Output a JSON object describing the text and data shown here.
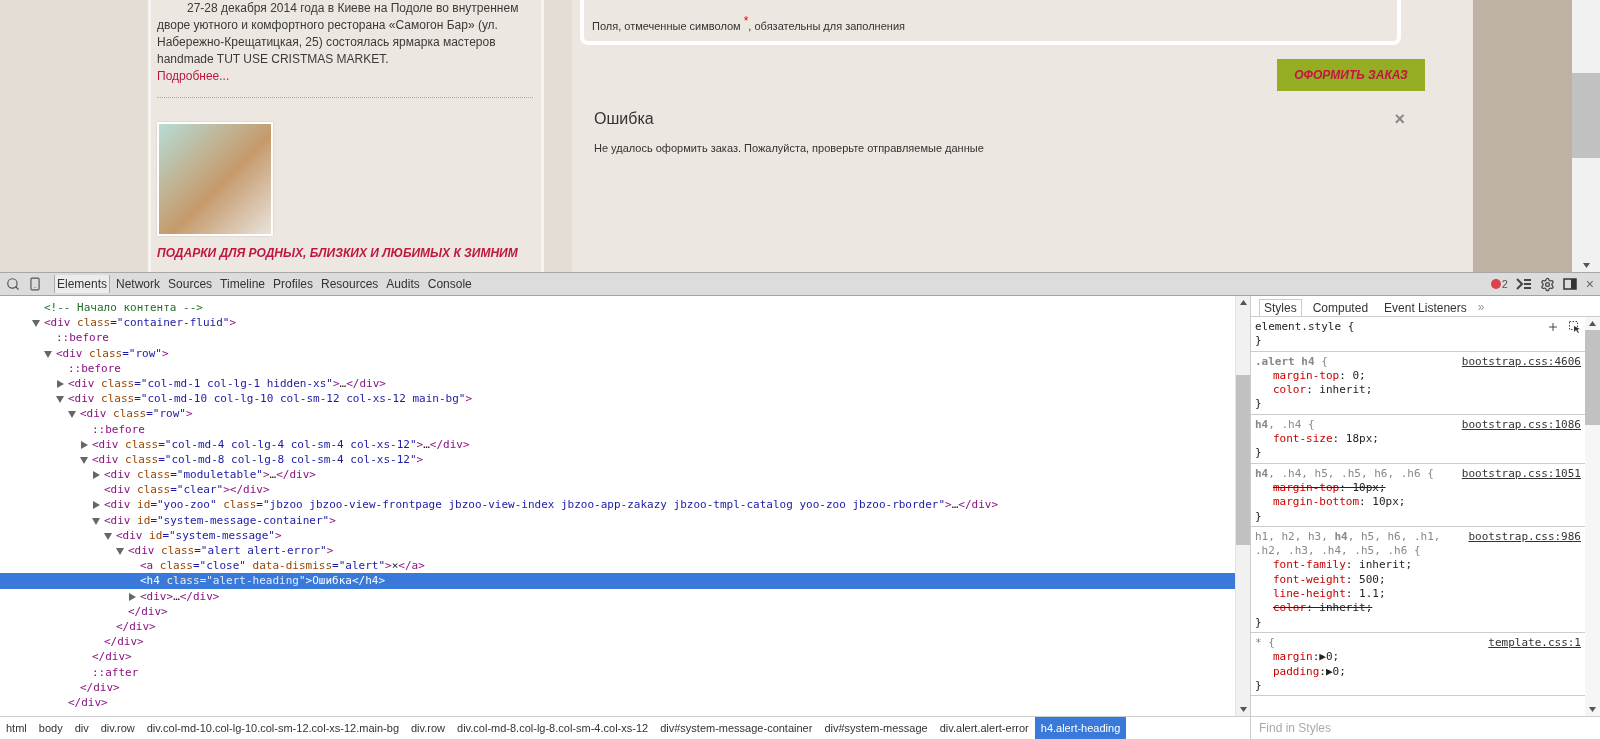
{
  "page": {
    "news": {
      "paragraph": "27-28 декабря 2014 года в Киеве на Подоле во внутреннем дворе уютного и комфортного ресторана «Самогон Бар» (ул. Набережно-Крещатицкая, 25) состоялась ярмарка мастеров handmade TUT USE CRISTMAS MARKET.",
      "more_link": "Подробнее...",
      "heading": "ПОДАРКИ ДЛЯ РОДНЫХ, БЛИЗКИХ И ЛЮБИМЫХ К ЗИМНИМ"
    },
    "form_note": "Поля, отмеченные символом $^{*}$, обязательны для заполнения",
    "submit_button": "ОФОРМИТЬ ЗАКАЗ",
    "alert": {
      "title": "Ошибка",
      "close": "×",
      "message": "Не удалось оформить заказ. Пожалуйста, проверьте отправляемые данные"
    }
  },
  "devtools": {
    "tabs": [
      {
        "label": "Elements",
        "selected": true
      },
      {
        "label": "Network",
        "selected": false
      },
      {
        "label": "Sources",
        "selected": false
      },
      {
        "label": "Timeline",
        "selected": false
      },
      {
        "label": "Profiles",
        "selected": false
      },
      {
        "label": "Resources",
        "selected": false
      },
      {
        "label": "Audits",
        "selected": false
      },
      {
        "label": "Console",
        "selected": false
      }
    ],
    "error_count": "2",
    "close": "×",
    "dom_tree": [
      {
        "segments": [
          {
            "kind": "comment",
            "text": "<!-- Начало контента -->"
          }
        ],
        "selected": false
      },
      {
        "segments": [
          {
            "kind": "tag",
            "text": "<div"
          },
          {
            "kind": "attr",
            "text": " class"
          },
          {
            "kind": "value",
            "text": "=\"container-fluid\""
          },
          {
            "kind": "tag",
            "text": ">"
          }
        ],
        "expanded": true,
        "selected": false,
        "children": [
          {
            "segments": [
              {
                "kind": "pseudo",
                "text": "::before"
              }
            ],
            "selected": false
          },
          {
            "segments": [
              {
                "kind": "tag",
                "text": "<div"
              },
              {
                "kind": "attr",
                "text": " class"
              },
              {
                "kind": "value",
                "text": "=\"row\""
              },
              {
                "kind": "tag",
                "text": ">"
              }
            ],
            "expanded": true,
            "selected": false,
            "children": [
              {
                "segments": [
                  {
                    "kind": "pseudo",
                    "text": "::before"
                  }
                ],
                "selected": false
              },
              {
                "segments": [
                  {
                    "kind": "tag",
                    "text": "<div"
                  },
                  {
                    "kind": "attr",
                    "text": " class"
                  },
                  {
                    "kind": "value",
                    "text": "=\"col-md-1 col-lg-1 hidden-xs\""
                  },
                  {
                    "kind": "tag",
                    "text": ">"
                  },
                  {
                    "kind": "text",
                    "text": "…"
                  },
                  {
                    "kind": "tag",
                    "text": "</div>"
                  }
                ],
                "expanded": false,
                "selected": false
              },
              {
                "segments": [
                  {
                    "kind": "tag",
                    "text": "<div"
                  },
                  {
                    "kind": "attr",
                    "text": " class"
                  },
                  {
                    "kind": "value",
                    "text": "=\"col-md-10 col-lg-10 col-sm-12 col-xs-12 main-bg\""
                  },
                  {
                    "kind": "tag",
                    "text": ">"
                  }
                ],
                "expanded": true,
                "selected": false,
                "close": [
                  {
                    "kind": "tag",
                    "text": "</div>"
                  }
                ],
                "children": [
                  {
                    "segments": [
                      {
                        "kind": "tag",
                        "text": "<div"
                      },
                      {
                        "kind": "attr",
                        "text": " class"
                      },
                      {
                        "kind": "value",
                        "text": "=\"row\""
                      },
                      {
                        "kind": "tag",
                        "text": ">"
                      }
                    ],
                    "expanded": true,
                    "selected": false,
                    "close": [
                      {
                        "kind": "tag",
                        "text": "</div>"
                      }
                    ],
                    "children": [
                      {
                        "segments": [
                          {
                            "kind": "pseudo",
                            "text": "::before"
                          }
                        ],
                        "selected": false
                      },
                      {
                        "segments": [
                          {
                            "kind": "tag",
                            "text": "<div"
                          },
                          {
                            "kind": "attr",
                            "text": " class"
                          },
                          {
                            "kind": "value",
                            "text": "=\"col-md-4 col-lg-4 col-sm-4 col-xs-12\""
                          },
                          {
                            "kind": "tag",
                            "text": ">"
                          },
                          {
                            "kind": "text",
                            "text": "…"
                          },
                          {
                            "kind": "tag",
                            "text": "</div>"
                          }
                        ],
                        "expanded": false,
                        "selected": false
                      },
                      {
                        "segments": [
                          {
                            "kind": "tag",
                            "text": "<div"
                          },
                          {
                            "kind": "attr",
                            "text": " class"
                          },
                          {
                            "kind": "value",
                            "text": "=\"col-md-8 col-lg-8 col-sm-4 col-xs-12\""
                          },
                          {
                            "kind": "tag",
                            "text": ">"
                          }
                        ],
                        "expanded": true,
                        "selected": false,
                        "close": [
                          {
                            "kind": "tag",
                            "text": "</div>"
                          }
                        ],
                        "children": [
                          {
                            "segments": [
                              {
                                "kind": "tag",
                                "text": "<div"
                              },
                              {
                                "kind": "attr",
                                "text": " class"
                              },
                              {
                                "kind": "value",
                                "text": "=\"moduletable\""
                              },
                              {
                                "kind": "tag",
                                "text": ">"
                              },
                              {
                                "kind": "text",
                                "text": "…"
                              },
                              {
                                "kind": "tag",
                                "text": "</div>"
                              }
                            ],
                            "expanded": false,
                            "selected": false
                          },
                          {
                            "segments": [
                              {
                                "kind": "tag",
                                "text": "<div"
                              },
                              {
                                "kind": "attr",
                                "text": " class"
                              },
                              {
                                "kind": "value",
                                "text": "=\"clear\""
                              },
                              {
                                "kind": "tag",
                                "text": "></div>"
                              }
                            ],
                            "selected": false
                          },
                          {
                            "segments": [
                              {
                                "kind": "tag",
                                "text": "<div"
                              },
                              {
                                "kind": "attr",
                                "text": " id"
                              },
                              {
                                "kind": "value",
                                "text": "=\"yoo-zoo\""
                              },
                              {
                                "kind": "attr",
                                "text": " class"
                              },
                              {
                                "kind": "value",
                                "text": "=\"jbzoo jbzoo-view-frontpage jbzoo-view-index jbzoo-app-zakazy jbzoo-tmpl-catalog yoo-zoo jbzoo-rborder\""
                              },
                              {
                                "kind": "tag",
                                "text": ">"
                              },
                              {
                                "kind": "text",
                                "text": "…"
                              },
                              {
                                "kind": "tag",
                                "text": "</div>"
                              }
                            ],
                            "expanded": false,
                            "selected": false
                          },
                          {
                            "segments": [
                              {
                                "kind": "tag",
                                "text": "<div"
                              },
                              {
                                "kind": "attr",
                                "text": " id"
                              },
                              {
                                "kind": "value",
                                "text": "=\"system-message-container\""
                              },
                              {
                                "kind": "tag",
                                "text": ">"
                              }
                            ],
                            "expanded": true,
                            "selected": false,
                            "close": [
                              {
                                "kind": "tag",
                                "text": "</div>"
                              }
                            ],
                            "children": [
                              {
                                "segments": [
                                  {
                                    "kind": "tag",
                                    "text": "<div"
                                  },
                                  {
                                    "kind": "attr",
                                    "text": " id"
                                  },
                                  {
                                    "kind": "value",
                                    "text": "=\"system-message\""
                                  },
                                  {
                                    "kind": "tag",
                                    "text": ">"
                                  }
                                ],
                                "expanded": true,
                                "selected": false,
                                "close": [
                                  {
                                    "kind": "tag",
                                    "text": "</div>"
                                  }
                                ],
                                "children": [
                                  {
                                    "segments": [
                                      {
                                        "kind": "tag",
                                        "text": "<div"
                                      },
                                      {
                                        "kind": "attr",
                                        "text": " class"
                                      },
                                      {
                                        "kind": "value",
                                        "text": "=\"alert alert-error\""
                                      },
                                      {
                                        "kind": "tag",
                                        "text": ">"
                                      }
                                    ],
                                    "expanded": true,
                                    "selected": false,
                                    "close": [
                                      {
                                        "kind": "tag",
                                        "text": "</div>"
                                      }
                                    ],
                                    "children": [
                                      {
                                        "segments": [
                                          {
                                            "kind": "tag",
                                            "text": "<a"
                                          },
                                          {
                                            "kind": "attr",
                                            "text": " class"
                                          },
                                          {
                                            "kind": "value",
                                            "text": "=\"close\""
                                          },
                                          {
                                            "kind": "attr",
                                            "text": " data-dismiss"
                                          },
                                          {
                                            "kind": "value",
                                            "text": "=\"alert\""
                                          },
                                          {
                                            "kind": "tag",
                                            "text": ">"
                                          },
                                          {
                                            "kind": "text",
                                            "text": "×"
                                          },
                                          {
                                            "kind": "tag",
                                            "text": "</a>"
                                          }
                                        ],
                                        "selected": false
                                      },
                                      {
                                        "segments": [
                                          {
                                            "kind": "tag",
                                            "text": "<h4"
                                          },
                                          {
                                            "kind": "attr",
                                            "text": " class"
                                          },
                                          {
                                            "kind": "value",
                                            "text": "=\"alert-heading\""
                                          },
                                          {
                                            "kind": "tag",
                                            "text": ">"
                                          },
                                          {
                                            "kind": "text",
                                            "text": "Ошибка"
                                          },
                                          {
                                            "kind": "tag",
                                            "text": "</h4>"
                                          }
                                        ],
                                        "selected": true
                                      },
                                      {
                                        "segments": [
                                          {
                                            "kind": "tag",
                                            "text": "<div>"
                                          },
                                          {
                                            "kind": "text",
                                            "text": "…"
                                          },
                                          {
                                            "kind": "tag",
                                            "text": "</div>"
                                          }
                                        ],
                                        "expanded": false,
                                        "selected": false
                                      }
                                    ]
                                  }
                                ]
                              }
                            ]
                          }
                        ]
                      },
                      {
                        "segments": [
                          {
                            "kind": "pseudo",
                            "text": "::after"
                          }
                        ],
                        "selected": false
                      }
                    ]
                  }
                ]
              }
            ]
          }
        ]
      }
    ],
    "breadcrumbs": [
      {
        "label": "html",
        "selected": false
      },
      {
        "label": "body",
        "selected": false
      },
      {
        "label": "div",
        "selected": false
      },
      {
        "label": "div.row",
        "selected": false
      },
      {
        "label": "div.col-md-10.col-lg-10.col-sm-12.col-xs-12.main-bg",
        "selected": false
      },
      {
        "label": "div.row",
        "selected": false
      },
      {
        "label": "div.col-md-8.col-lg-8.col-sm-4.col-xs-12",
        "selected": false
      },
      {
        "label": "div#system-message-container",
        "selected": false
      },
      {
        "label": "div#system-message",
        "selected": false
      },
      {
        "label": "div.alert.alert-error",
        "selected": false
      },
      {
        "label": "h4.alert-heading",
        "selected": true
      }
    ],
    "styles_tabs": [
      {
        "label": "Styles",
        "selected": true
      },
      {
        "label": "Computed",
        "selected": false
      },
      {
        "label": "Event Listeners",
        "selected": false
      }
    ],
    "styles_more": "»",
    "rules": [
      {
        "kind": "inline",
        "selector": "element.style {",
        "end": "}"
      },
      {
        "kind": "rule",
        "selector": "**.alert h4** {",
        "source": "bootstrap.css:4606",
        "end": "}",
        "properties": [
          {
            "name": "margin-top",
            "value": ": 0;",
            "overridden": false
          },
          {
            "name": "color",
            "value": ": inherit;",
            "overridden": false
          }
        ]
      },
      {
        "kind": "rule",
        "selector": "**h4**, .h4 {",
        "source": "bootstrap.css:1086",
        "end": "}",
        "properties": [
          {
            "name": "font-size",
            "value": ": 18px;",
            "overridden": false
          }
        ]
      },
      {
        "kind": "rule",
        "selector": "**h4**, .h4, h5, .h5, h6, .h6 {",
        "source": "bootstrap.css:1051",
        "end": "}",
        "properties": [
          {
            "name": "margin-top",
            "value": ": 10px;",
            "overridden": true
          },
          {
            "name": "margin-bottom",
            "value": ": 10px;",
            "overridden": false
          }
        ]
      },
      {
        "kind": "rule",
        "selector": "h1, h2, h3, **h4**, h5, h6, .h1, .h2, .h3, .h4, .h5, .h6 {",
        "source": "bootstrap.css:986",
        "end": "}",
        "properties": [
          {
            "name": "font-family",
            "value": ": inherit;",
            "overridden": false
          },
          {
            "name": "font-weight",
            "value": ": 500;",
            "overridden": false
          },
          {
            "name": "line-height",
            "value": ": 1.1;",
            "overridden": false
          },
          {
            "name": "color",
            "value": ": inherit;",
            "overridden": true
          }
        ]
      },
      {
        "kind": "rule",
        "selector": "* {",
        "source": "template.css:1",
        "end": "}",
        "properties": [
          {
            "name": "margin",
            "value": ":▶0;",
            "overridden": false
          },
          {
            "name": "padding",
            "value": ":▶0;",
            "overridden": false
          }
        ]
      }
    ],
    "find_placeholder": "Find in Styles"
  }
}
